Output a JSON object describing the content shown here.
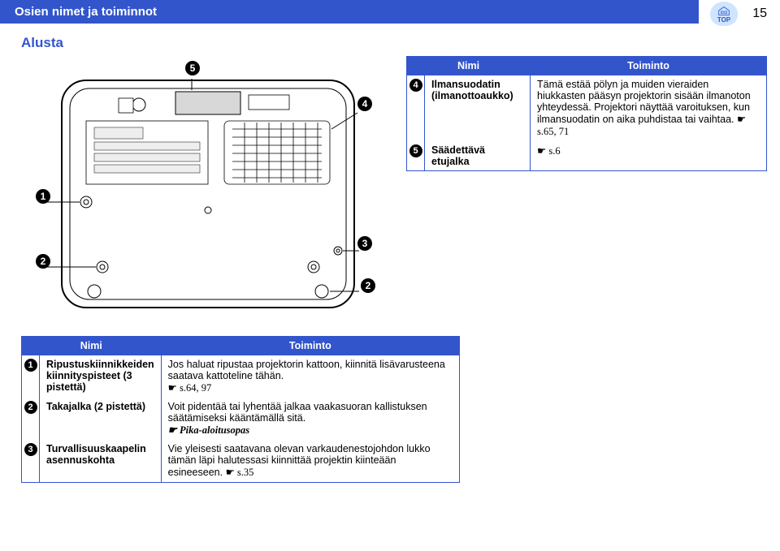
{
  "header": {
    "title": "Osien nimet ja toiminnot",
    "page_num": "15",
    "top_label": "TOP"
  },
  "section_title": "Alusta",
  "table_headers": {
    "name": "Nimi",
    "func": "Toiminto"
  },
  "top_table": [
    {
      "num": "4",
      "name": "Ilmansuodatin (ilmanottoaukko)",
      "func": "Tämä estää pölyn ja muiden vieraiden hiukkasten pääsyn projektorin sisään ilmanoton yhteydessä. Projektori näyttää varoituksen, kun ilmansuodatin on aika puhdistaa tai vaihtaa. ",
      "ref": "☛ s.65, 71"
    },
    {
      "num": "5",
      "name": "Säädettävä etujalka",
      "func": "",
      "ref": "☛ s.6"
    }
  ],
  "bottom_table": [
    {
      "num": "1",
      "name": "Ripustuskiinnikkeiden kiinnityspisteet (3 pistettä)",
      "func": "Jos haluat ripustaa projektorin kattoon, kiinnitä lisävarusteena saatava kattoteline tähän.",
      "ref": "☛ s.64, 97"
    },
    {
      "num": "2",
      "name": "Takajalka (2 pistettä)",
      "func": "Voit pidentää tai lyhentää jalkaa vaakasuoran kallistuksen säätämiseksi kääntämällä sitä.",
      "ref": "☛ Pika-aloitusopas"
    },
    {
      "num": "3",
      "name": "Turvallisuuskaapelin asennuskohta",
      "func": "Vie yleisesti saatavana olevan varkaudenestojohdon lukko tämän läpi halutessasi kiinnittää projektin kiinteään esineeseen. ",
      "ref": "☛ s.35"
    }
  ],
  "callouts": {
    "c1": "1",
    "c2a": "2",
    "c2b": "2",
    "c3": "3",
    "c4": "4",
    "c5": "5"
  }
}
